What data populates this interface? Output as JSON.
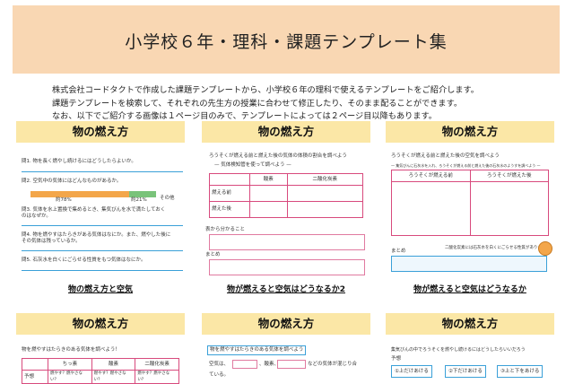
{
  "header": {
    "title": "小学校６年・理科・課題テンプレート集"
  },
  "intro": {
    "lines": [
      "株式会社コードタクトで作成した課題テンプレートから、小学校６年の理科で使えるテンプレートをご紹介します。",
      "課題テンプレートを検索して、それぞれの先生方の授業に合わせて修正したり、そのまま配ることができます。",
      "なお、以下でご紹介する画像は１ページ目のみで、テンプレートによっては２ページ目以降もあります。"
    ]
  },
  "cards": [
    {
      "title": "物の燃え方",
      "caption": "物の燃え方と空気",
      "q1": "問1. 物を長く燃やし続けるにはどうしたらよいか。",
      "q2": "問2. 空気中の気体にはどんなものがあるか。",
      "bar1": "約78%",
      "bar2": "約21%",
      "bar3": "その他",
      "q3a": "問3. 気体を水上置換で集めるとき、集気びんを水で満たしておく",
      "q3b": "のはなぜか。",
      "q4a": "問4. 物を燃やすはたらきがある気体はなにか。また、燃やした後に",
      "q4b": "その気体は残っているか。",
      "q5": "問5. 石灰水を白くにごらせる性質をもつ気体はなにか。"
    },
    {
      "title": "物の燃え方",
      "caption": "物が燃えると空気はどうなるか2",
      "lead": "ろうそくが燃える前と燃えた後の気体の体積の割合を調べよう",
      "sub": "— 気体検知管を使って調べよう —",
      "col1": "酸素",
      "col2": "二酸化炭素",
      "row1": "燃える前",
      "row2": "燃えた後",
      "label1": "表から分かること",
      "label2": "まとめ"
    },
    {
      "title": "物の燃え方",
      "caption": "物が燃えると空気はどうなるか",
      "lead": "ろうそくが燃える前と燃えた後の空気を調べよう",
      "sub": "— 集気びんに石灰水を入れ、ろうそくが燃える前と燃えた後の石灰水のようすを調べよう —",
      "col1": "ろうそくが燃える前",
      "col2": "ろうそくが燃えた後",
      "note": "二酸化炭素には石灰水を白くにごらせる性質があります。",
      "label": "まとめ"
    },
    {
      "title": "物の燃え方",
      "lead": "物を燃やすはたらきのある気体を調べよう！",
      "col1": "ちっ素",
      "col2": "酸素",
      "col3": "二酸化炭素",
      "row1": "予想",
      "c1": "燃やす？燃やさない？",
      "c2": "燃やす？燃やさない？",
      "c3": "燃やす？燃やさない？"
    },
    {
      "title": "物の燃え方",
      "lead": "物を燃やすはたらきのある気体を調べよう",
      "text1": "空気は、",
      "text2": "、酸素、",
      "text3": "などの気体が混じり合",
      "text4": "ている。"
    },
    {
      "title": "物の燃え方",
      "lead": "集気びんの中でろうそくを燃やし続けるにはどうしたらいいだろう",
      "label": "予想",
      "opt1": "①上だけあける",
      "opt2": "②下だけあける",
      "opt3": "③上と下をあける"
    }
  ]
}
